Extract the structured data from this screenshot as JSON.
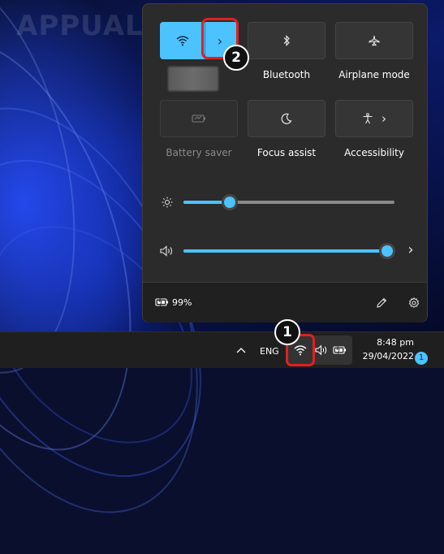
{
  "watermark": "APPUALS",
  "colors": {
    "accent": "#4cc2ff",
    "panel": "#2b2b2b",
    "tile": "#353535",
    "highlight": "#e02020",
    "taskbar": "#1f1f1f"
  },
  "quick_settings": {
    "tiles": [
      {
        "label": "",
        "icon": "wifi-icon",
        "active": true,
        "has_arrow": true
      },
      {
        "label": "Bluetooth",
        "icon": "bluetooth-icon",
        "active": false
      },
      {
        "label": "Airplane mode",
        "icon": "airplane-icon",
        "active": false
      },
      {
        "label": "Battery saver",
        "icon": "battery-saver-icon",
        "active": false,
        "disabled": true
      },
      {
        "label": "Focus assist",
        "icon": "moon-icon",
        "active": false
      },
      {
        "label": "Accessibility",
        "icon": "accessibility-icon",
        "active": false,
        "has_arrow": true
      }
    ],
    "brightness": {
      "icon": "brightness-icon",
      "level": 0.21
    },
    "volume": {
      "icon": "speaker-icon",
      "level": 1.0
    },
    "footer": {
      "battery_percent": "99%",
      "icons": [
        "battery-charging-icon",
        "pencil-icon",
        "gear-icon"
      ]
    }
  },
  "taskbar": {
    "language": "ENG",
    "time": "8:48 pm",
    "date": "29/04/2022",
    "notification_count": "1",
    "tray_icons": [
      "chevron-up-icon",
      "wifi-icon",
      "speaker-icon",
      "battery-charging-icon"
    ]
  },
  "callouts": [
    "1",
    "2"
  ]
}
